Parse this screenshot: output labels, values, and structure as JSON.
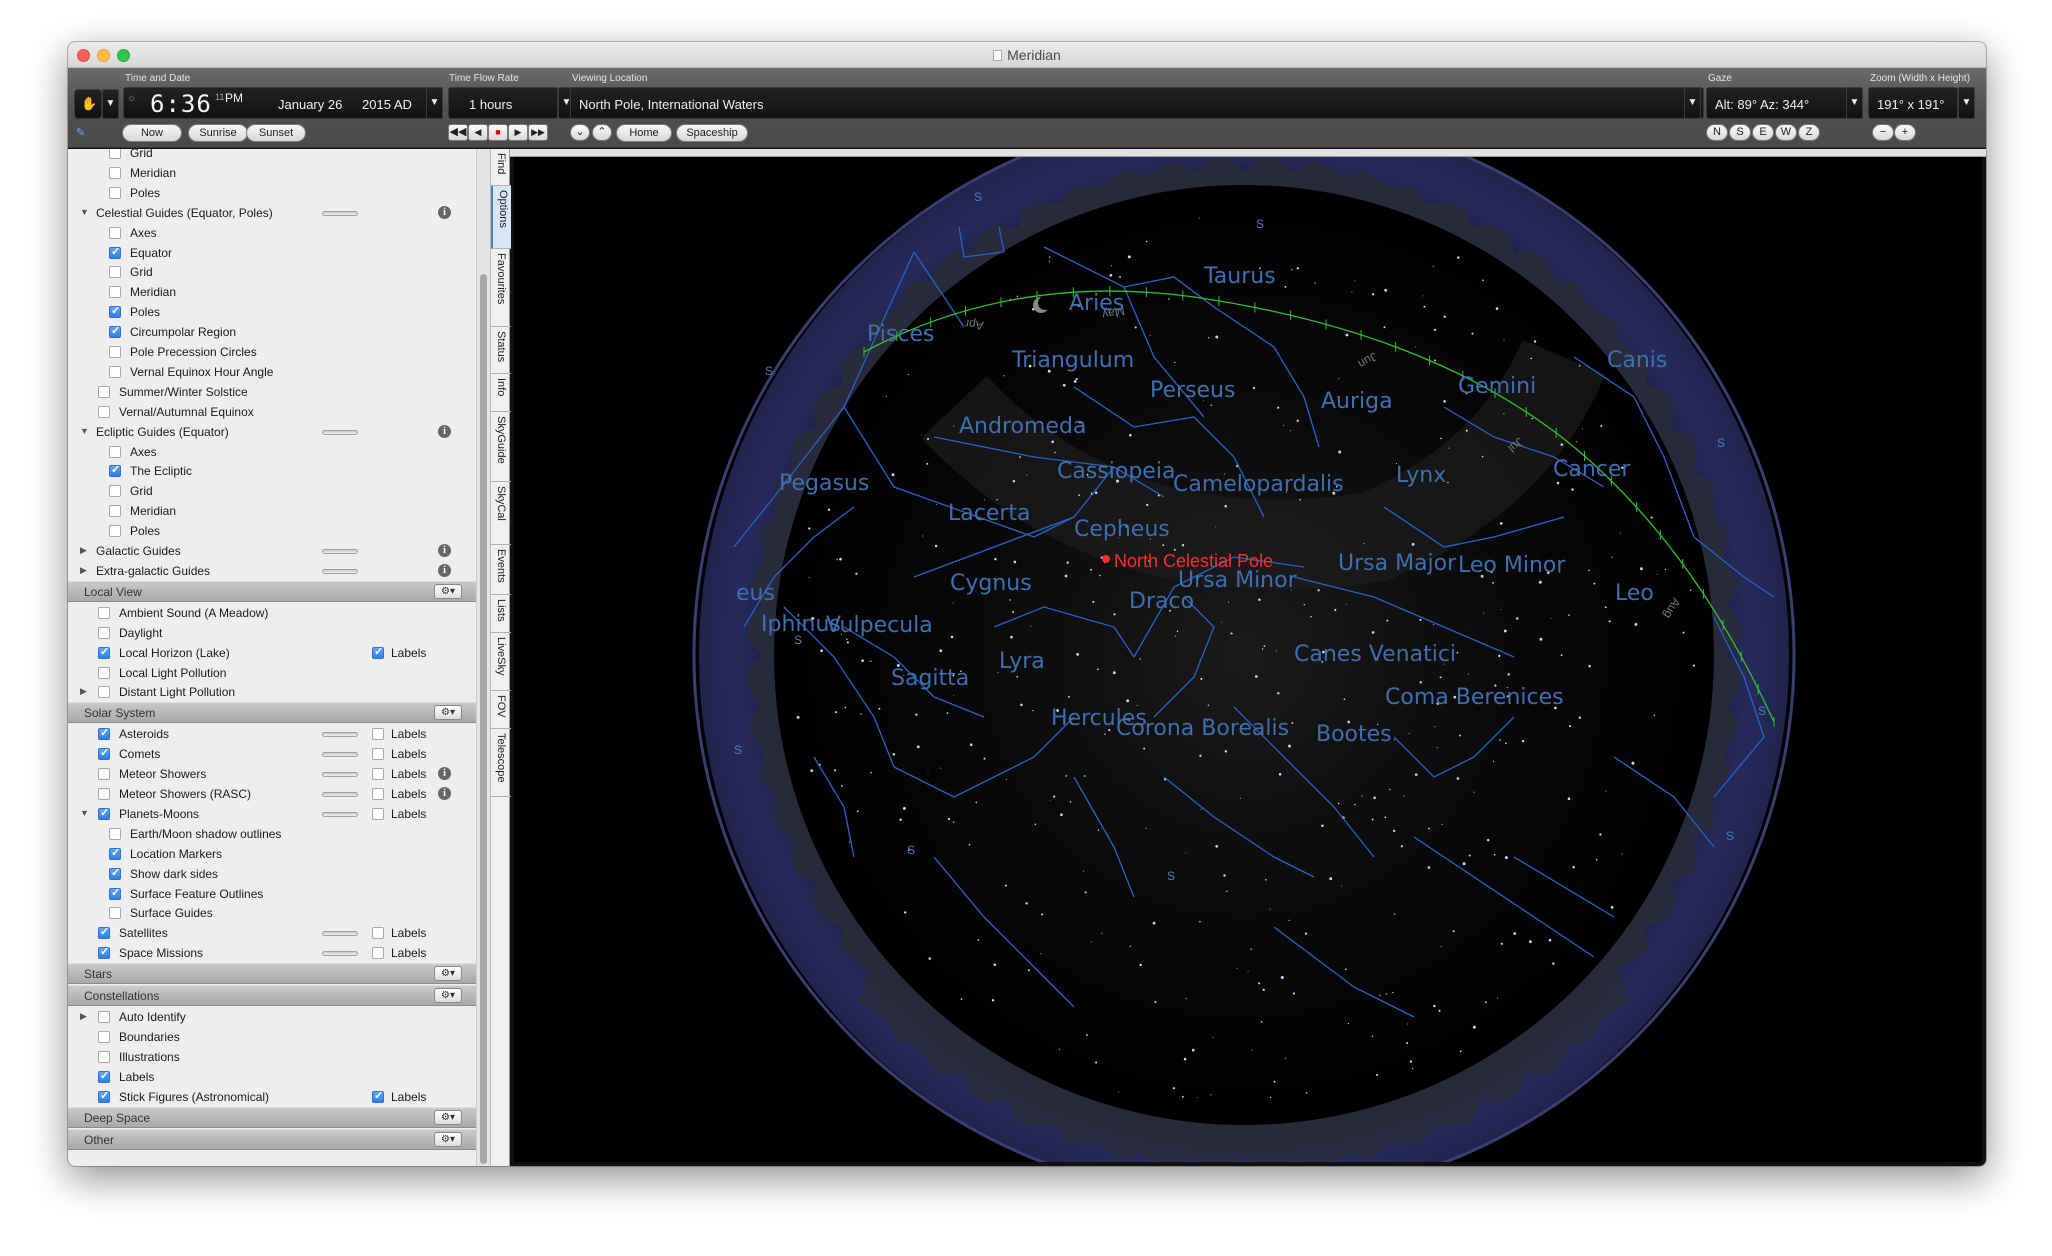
{
  "window": {
    "title": "Meridian"
  },
  "toolbar": {
    "time_and_date_label": "Time and Date",
    "time": "6:36",
    "ampm": "PM",
    "date": "January 26",
    "year": "2015 AD",
    "now": "Now",
    "sunrise": "Sunrise",
    "sunset": "Sunset",
    "time_flow_label": "Time Flow Rate",
    "time_flow_value": "1 hours",
    "viewing_location_label": "Viewing Location",
    "viewing_location_value": "North Pole, International Waters",
    "home": "Home",
    "spaceship": "Spaceship",
    "gaze_label": "Gaze",
    "gaze_value": "Alt: 89° Az: 344°",
    "gaze_buttons": [
      "N",
      "S",
      "E",
      "W",
      "Z"
    ],
    "zoom_label": "Zoom (Width x Height)",
    "zoom_value": "191° x 191°",
    "zoom_out": "−",
    "zoom_in": "+"
  },
  "sidebar": {
    "rows": [
      {
        "label": "Grid",
        "indent": 2,
        "checked": false
      },
      {
        "label": "Meridian",
        "indent": 2,
        "checked": false
      },
      {
        "label": "Poles",
        "indent": 2,
        "checked": false
      },
      {
        "label": "Celestial Guides (Equator, Poles)",
        "indent": 0,
        "tri": "down",
        "slider": true,
        "info": true
      },
      {
        "label": "Axes",
        "indent": 2,
        "checked": false
      },
      {
        "label": "Equator",
        "indent": 2,
        "checked": true
      },
      {
        "label": "Grid",
        "indent": 2,
        "checked": false
      },
      {
        "label": "Meridian",
        "indent": 2,
        "checked": false
      },
      {
        "label": "Poles",
        "indent": 2,
        "checked": true
      },
      {
        "label": "Circumpolar Region",
        "indent": 2,
        "checked": true
      },
      {
        "label": "Pole Precession Circles",
        "indent": 2,
        "checked": false
      },
      {
        "label": "Vernal Equinox Hour Angle",
        "indent": 2,
        "checked": false
      },
      {
        "label": "Summer/Winter Solstice",
        "indent": 1,
        "checked": false
      },
      {
        "label": "Vernal/Autumnal Equinox",
        "indent": 1,
        "checked": false
      },
      {
        "label": "Ecliptic Guides (Equator)",
        "indent": 0,
        "tri": "down",
        "slider": true,
        "info": true
      },
      {
        "label": "Axes",
        "indent": 2,
        "checked": false
      },
      {
        "label": "The Ecliptic",
        "indent": 2,
        "checked": true
      },
      {
        "label": "Grid",
        "indent": 2,
        "checked": false
      },
      {
        "label": "Meridian",
        "indent": 2,
        "checked": false
      },
      {
        "label": "Poles",
        "indent": 2,
        "checked": false
      },
      {
        "label": "Galactic Guides",
        "indent": 0,
        "tri": "right",
        "slider": true,
        "info": true
      },
      {
        "label": "Extra-galactic Guides",
        "indent": 0,
        "tri": "right",
        "slider": true,
        "info": true
      },
      {
        "section": "Local View"
      },
      {
        "label": "Ambient Sound (A Meadow)",
        "indent": 1,
        "checked": false
      },
      {
        "label": "Daylight",
        "indent": 1,
        "checked": false
      },
      {
        "label": "Local Horizon (Lake)",
        "indent": 1,
        "checked": true,
        "labels": true,
        "labels_checked": true
      },
      {
        "label": "Local Light Pollution",
        "indent": 1,
        "checked": false
      },
      {
        "label": "Distant Light Pollution",
        "indent": 1,
        "checked": false,
        "tri": "right"
      },
      {
        "section": "Solar System"
      },
      {
        "label": "Asteroids",
        "indent": 1,
        "checked": true,
        "slider": true,
        "labels": true,
        "labels_checked": false
      },
      {
        "label": "Comets",
        "indent": 1,
        "checked": true,
        "slider": true,
        "labels": true,
        "labels_checked": false
      },
      {
        "label": "Meteor Showers",
        "indent": 1,
        "checked": false,
        "slider": true,
        "labels": true,
        "labels_checked": false,
        "info": true
      },
      {
        "label": "Meteor Showers (RASC)",
        "indent": 1,
        "checked": false,
        "slider": true,
        "labels": true,
        "labels_checked": false,
        "info": true
      },
      {
        "label": "Planets-Moons",
        "indent": 1,
        "checked": true,
        "tri": "down",
        "slider": true,
        "labels": true,
        "labels_checked": false
      },
      {
        "label": "Earth/Moon shadow outlines",
        "indent": 2,
        "checked": false
      },
      {
        "label": "Location Markers",
        "indent": 2,
        "checked": true
      },
      {
        "label": "Show dark sides",
        "indent": 2,
        "checked": true
      },
      {
        "label": "Surface Feature Outlines",
        "indent": 2,
        "checked": true
      },
      {
        "label": "Surface Guides",
        "indent": 2,
        "checked": false
      },
      {
        "label": "Satellites",
        "indent": 1,
        "checked": true,
        "slider": true,
        "labels": true,
        "labels_checked": false
      },
      {
        "label": "Space Missions",
        "indent": 1,
        "checked": true,
        "slider": true,
        "labels": true,
        "labels_checked": false
      },
      {
        "section": "Stars"
      },
      {
        "section": "Constellations"
      },
      {
        "label": "Auto Identify",
        "indent": 1,
        "checked": false,
        "tri": "right"
      },
      {
        "label": "Boundaries",
        "indent": 1,
        "checked": false
      },
      {
        "label": "Illustrations",
        "indent": 1,
        "checked": false
      },
      {
        "label": "Labels",
        "indent": 1,
        "checked": true
      },
      {
        "label": "Stick Figures (Astronomical)",
        "indent": 1,
        "checked": true,
        "labels": true,
        "labels_checked": true
      },
      {
        "section": "Deep Space"
      },
      {
        "section": "Other"
      }
    ],
    "labels_text": "Labels"
  },
  "tabs": [
    "Find",
    "Options",
    "Favourites",
    "Status",
    "Info",
    "SkyGuide",
    "SkyCal",
    "Events",
    "Lists",
    "LiveSky",
    "FOV",
    "Telescope"
  ],
  "active_tab": "Options",
  "sky": {
    "pole_label": "North Celestial Pole",
    "constellations": [
      "Taurus",
      "Aries",
      "Pisces",
      "Triangulum",
      "Perseus",
      "Auriga",
      "Gemini",
      "Canis",
      "Andromeda",
      "Cassiopeia",
      "Camelopardalis",
      "Lynx",
      "Cancer",
      "Pegasus",
      "Lacerta",
      "Cepheus",
      "Ursa Major",
      "Leo Minor",
      "eus",
      "Cygnus",
      "Ursa Minor",
      "Leo",
      "Draco",
      "Iphinus",
      "Vulpecula",
      "Sagitta",
      "Lyra",
      "Canes Venatici",
      "Coma Berenices",
      "Hercules",
      "Corona Borealis",
      "Bootes"
    ],
    "months": [
      "Apr",
      "May",
      "Jun",
      "Jul",
      "Aug"
    ],
    "compass_marks": [
      "S",
      "S",
      "S",
      "S",
      "S",
      "S",
      "S",
      "S",
      "S",
      "S"
    ],
    "colors": {
      "lines": "#2a63c7",
      "labels": "#3f6fb0",
      "ecliptic": "#2fc22f",
      "pole": "#ff2a2a",
      "dome": "#1e2248"
    }
  }
}
